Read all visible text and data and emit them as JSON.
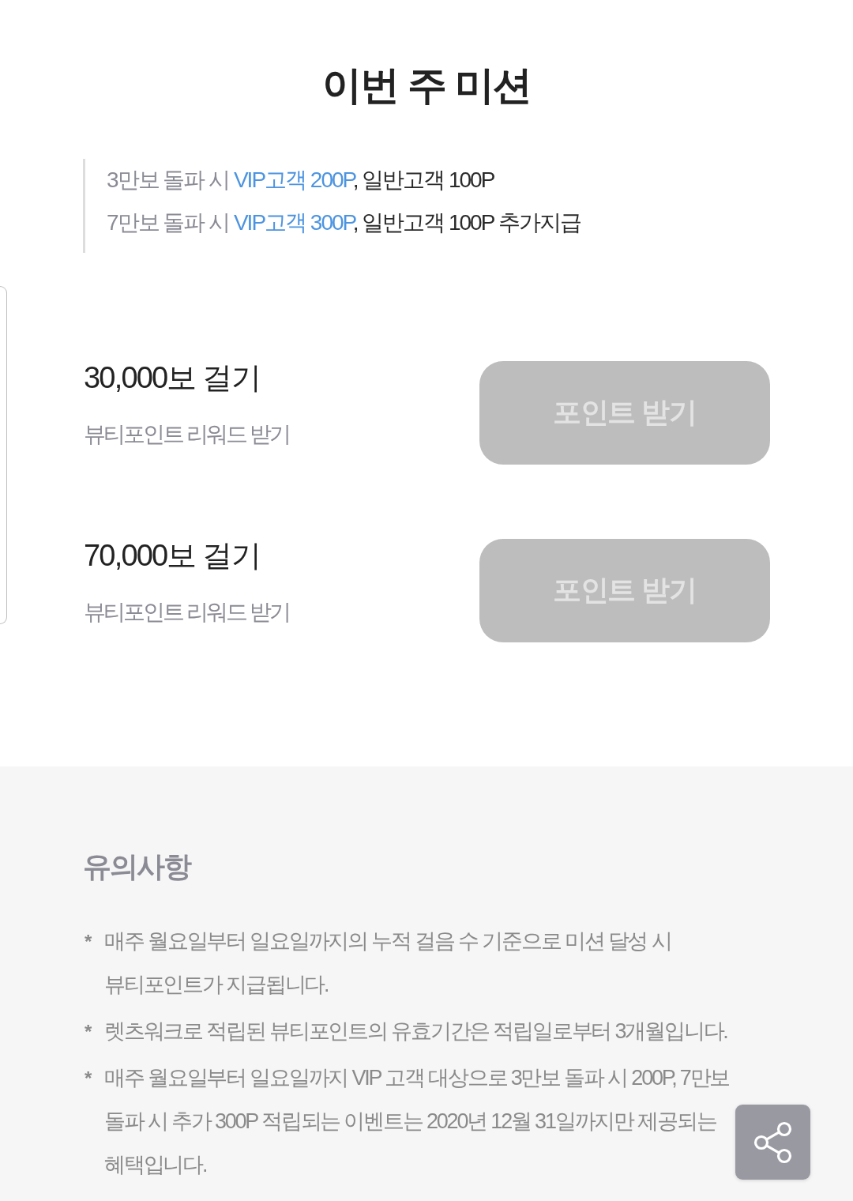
{
  "title": "이번 주 미션",
  "bonus_lines": [
    [
      {
        "kind": "condition",
        "text": "3만보 돌파 시 "
      },
      {
        "kind": "vip",
        "text": "VIP고객 200P"
      },
      {
        "kind": "general",
        "text": ", 일반고객 100P"
      }
    ],
    [
      {
        "kind": "condition",
        "text": "7만보 돌파 시 "
      },
      {
        "kind": "vip",
        "text": "VIP고객 300P"
      },
      {
        "kind": "general",
        "text": ", 일반고객 100P 추가지급"
      }
    ]
  ],
  "missions": [
    {
      "title": "30,000보 걸기",
      "subtitle": "뷰티포인트 리워드 받기",
      "button": {
        "label": "포인트 받기",
        "disabled": true
      }
    },
    {
      "title": "70,000보 걸기",
      "subtitle": "뷰티포인트 리워드 받기",
      "button": {
        "label": "포인트 받기",
        "disabled": true
      }
    }
  ],
  "notice": {
    "title": "유의사항",
    "items": [
      {
        "bullet": "*",
        "text": "매주 월요일부터 일요일까지의 누적 걸음 수 기준으로 미션 달성 시 뷰티포인트가 지급됩니다."
      },
      {
        "bullet": "*",
        "text": "렛츠워크로 적립된 뷰티포인트의 유효기간은 적립일로부터 3개월입니다."
      },
      {
        "bullet": "*",
        "text": "매주 월요일부터 일요일까지 VIP 고객 대상으로 3만보 돌파 시 200P, 7만보 돌파 시 추가 300P 적립되는 이벤트는 2020년 12월 31일까지만 제공되는 혜택입니다."
      }
    ]
  }
}
